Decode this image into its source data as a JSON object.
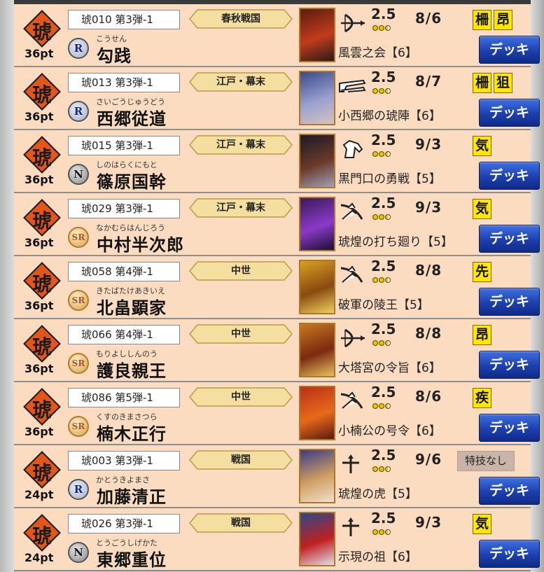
{
  "ui": {
    "deck_label": "デッキ",
    "no_skill_label": "特技なし",
    "family_kanji": "琥"
  },
  "colors": {
    "row_bg": "#fcdcc1",
    "era_fill": "#f5dfa0",
    "skill_bg": "#ffe600",
    "deck_button": "#1d3fae",
    "family_diamond": "#e2561a"
  },
  "cards": [
    {
      "points": "36pt",
      "id": "琥010 第3弾-1",
      "era": "春秋戦国",
      "rarity": "R",
      "ruby": "こうせん",
      "name": "勾践",
      "weapon": "bow-icon",
      "cost": "2.5",
      "cost_dots": [
        "full",
        "full",
        "half"
      ],
      "stats": "8/6",
      "skills": [
        "柵",
        "昂"
      ],
      "strategy": "風雲之会【6】",
      "thumb_colors": [
        "#5a1d12",
        "#c23b1c",
        "#2a1a18"
      ]
    },
    {
      "points": "36pt",
      "id": "琥013 第3弾-1",
      "era": "江戸・幕末",
      "rarity": "R",
      "ruby": "さいごうじゅうどう",
      "name": "西郷従道",
      "weapon": "gun-icon",
      "cost": "2.5",
      "cost_dots": [
        "full",
        "full",
        "half"
      ],
      "stats": "8/7",
      "skills": [
        "柵",
        "狙"
      ],
      "strategy": "小西郷の琥陣【6】",
      "thumb_colors": [
        "#3a4a8a",
        "#9aa0d0",
        "#d8c2c0"
      ]
    },
    {
      "points": "36pt",
      "id": "琥015 第3弾-1",
      "era": "江戸・幕末",
      "rarity": "N",
      "ruby": "しのはらくにもと",
      "name": "篠原国幹",
      "weapon": "horse-icon",
      "cost": "2.5",
      "cost_dots": [
        "full",
        "full",
        "half"
      ],
      "stats": "9/3",
      "skills": [
        "気"
      ],
      "strategy": "黒門口の勇戦【5】",
      "thumb_colors": [
        "#1a1a2a",
        "#6a3a2a",
        "#a0a0b8"
      ]
    },
    {
      "points": "36pt",
      "id": "琥029 第3弾-1",
      "era": "江戸・幕末",
      "rarity": "SR",
      "ruby": "なかむらはんじろう",
      "name": "中村半次郎",
      "weapon": "sword-icon",
      "cost": "2.5",
      "cost_dots": [
        "full",
        "full",
        "half"
      ],
      "stats": "9/3",
      "skills": [
        "気"
      ],
      "strategy": "琥煌の打ち廻り【5】",
      "thumb_colors": [
        "#3a1a5a",
        "#8a3ac8",
        "#1a1030"
      ]
    },
    {
      "points": "36pt",
      "id": "琥058 第4弾-1",
      "era": "中世",
      "rarity": "SR",
      "ruby": "きたばたけあきいえ",
      "name": "北畠顕家",
      "weapon": "sword-icon",
      "cost": "2.5",
      "cost_dots": [
        "full",
        "full",
        "half"
      ],
      "stats": "8/8",
      "skills": [
        "先"
      ],
      "strategy": "破軍の陵王【5】",
      "thumb_colors": [
        "#d8a020",
        "#8a4a10",
        "#f0d060"
      ]
    },
    {
      "points": "36pt",
      "id": "琥066 第4弾-1",
      "era": "中世",
      "rarity": "SR",
      "ruby": "もりよししんのう",
      "name": "護良親王",
      "weapon": "bow-icon",
      "cost": "2.5",
      "cost_dots": [
        "full",
        "full",
        "half"
      ],
      "stats": "8/8",
      "skills": [
        "昂"
      ],
      "strategy": "大塔宮の令旨【6】",
      "thumb_colors": [
        "#c87820",
        "#7a2a10",
        "#e8c060"
      ]
    },
    {
      "points": "36pt",
      "id": "琥086 第5弾-1",
      "era": "中世",
      "rarity": "SR",
      "ruby": "くすのきまさつら",
      "name": "楠木正行",
      "weapon": "sword-icon",
      "cost": "2.5",
      "cost_dots": [
        "full",
        "full",
        "half"
      ],
      "stats": "8/6",
      "skills": [
        "疾"
      ],
      "strategy": "小楠公の号令【6】",
      "thumb_colors": [
        "#b8301a",
        "#e86a1a",
        "#5a1a10"
      ]
    },
    {
      "points": "24pt",
      "id": "琥003 第3弾-1",
      "era": "戦国",
      "rarity": "R",
      "ruby": "かとうきよまさ",
      "name": "加藤清正",
      "weapon": "spear-icon",
      "cost": "2.5",
      "cost_dots": [
        "full",
        "full",
        "half"
      ],
      "stats": "9/6",
      "skills": [],
      "no_skill": true,
      "strategy": "琥煌の虎【5】",
      "thumb_colors": [
        "#3a3a8a",
        "#d0a060",
        "#f0e0d0"
      ]
    },
    {
      "points": "24pt",
      "id": "琥026 第3弾-1",
      "era": "戦国",
      "rarity": "N",
      "ruby": "とうごうしげかた",
      "name": "東郷重位",
      "weapon": "spear-icon",
      "cost": "2.5",
      "cost_dots": [
        "full",
        "full",
        "half"
      ],
      "stats": "9/3",
      "skills": [
        "気"
      ],
      "strategy": "示現の祖【6】",
      "thumb_colors": [
        "#2a4a8a",
        "#c02020",
        "#e0e0e8"
      ]
    }
  ]
}
